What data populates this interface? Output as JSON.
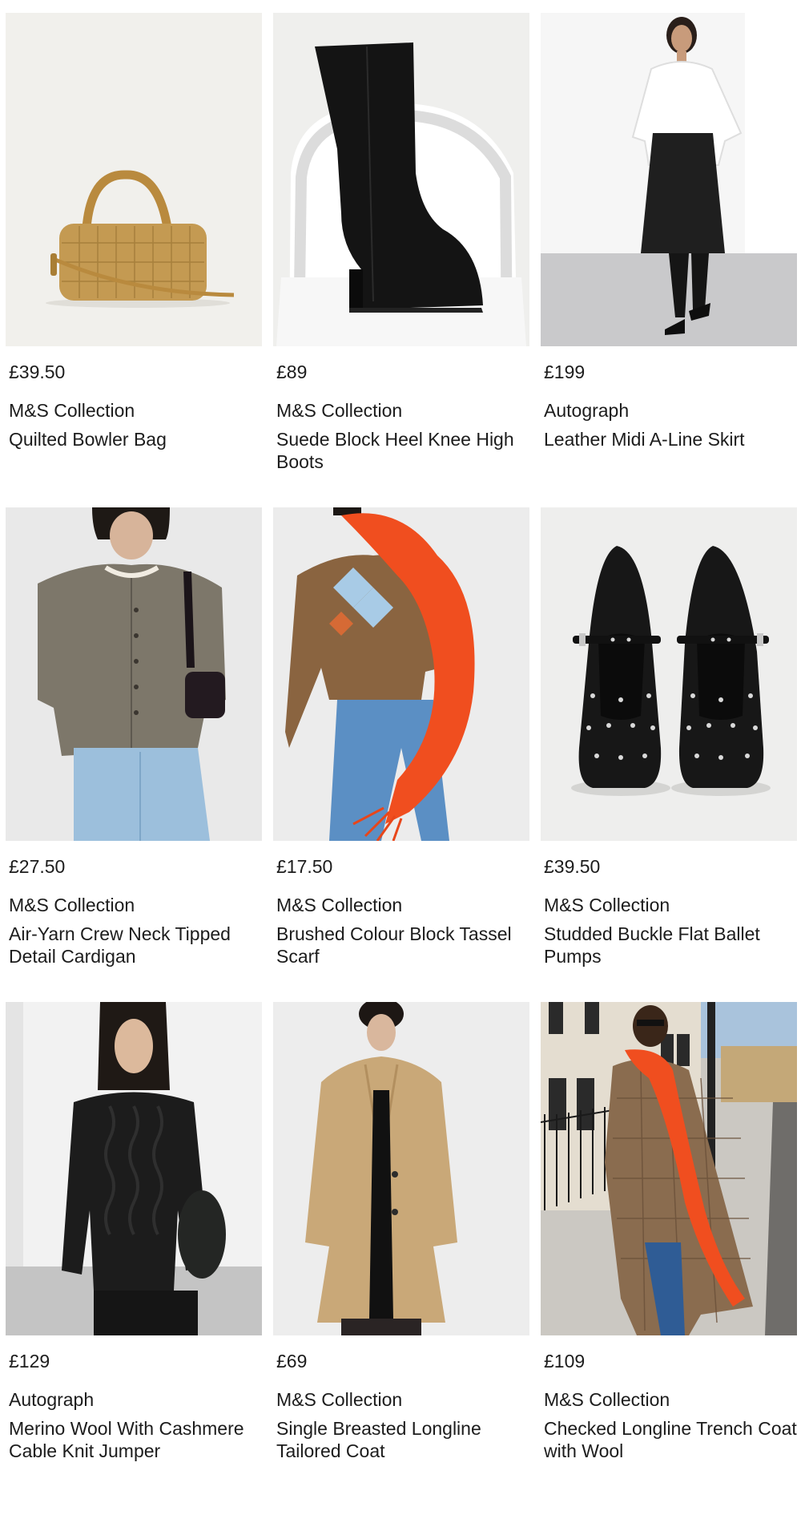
{
  "products": [
    {
      "price": "£39.50",
      "brand": "M&S Collection",
      "title": "Quilted Bowler Bag",
      "image": "quilted-bowler-bag-image"
    },
    {
      "price": "£89",
      "brand": "M&S Collection",
      "title": "Suede Block Heel Knee High Boots",
      "image": "knee-high-boot-image"
    },
    {
      "price": "£199",
      "brand": "Autograph",
      "title": "Leather Midi A-Line Skirt",
      "image": "leather-skirt-model-image"
    },
    {
      "price": "£27.50",
      "brand": "M&S Collection",
      "title": "Air-Yarn Crew Neck Tipped Detail Cardigan",
      "image": "cardigan-model-image"
    },
    {
      "price": "£17.50",
      "brand": "M&S Collection",
      "title": "Brushed Colour Block Tassel Scarf",
      "image": "orange-scarf-model-image"
    },
    {
      "price": "£39.50",
      "brand": "M&S Collection",
      "title": "Studded Buckle Flat Ballet Pumps",
      "image": "studded-ballet-pumps-image"
    },
    {
      "price": "£129",
      "brand": "Autograph",
      "title": "Merino Wool With Cashmere Cable Knit Jumper",
      "image": "cable-knit-jumper-model-image"
    },
    {
      "price": "£69",
      "brand": "M&S Collection",
      "title": "Single Breasted Longline Tailored Coat",
      "image": "camel-coat-model-image"
    },
    {
      "price": "£109",
      "brand": "M&S Collection",
      "title": "Checked Longline Trench Coat with Wool",
      "image": "checked-trench-street-model-image"
    }
  ],
  "colors": {
    "text": "#1c1c1c",
    "image_background": "#f0efed",
    "accent_orange": "#f04e1f",
    "tan": "#c49a52",
    "camel": "#c9a878"
  }
}
